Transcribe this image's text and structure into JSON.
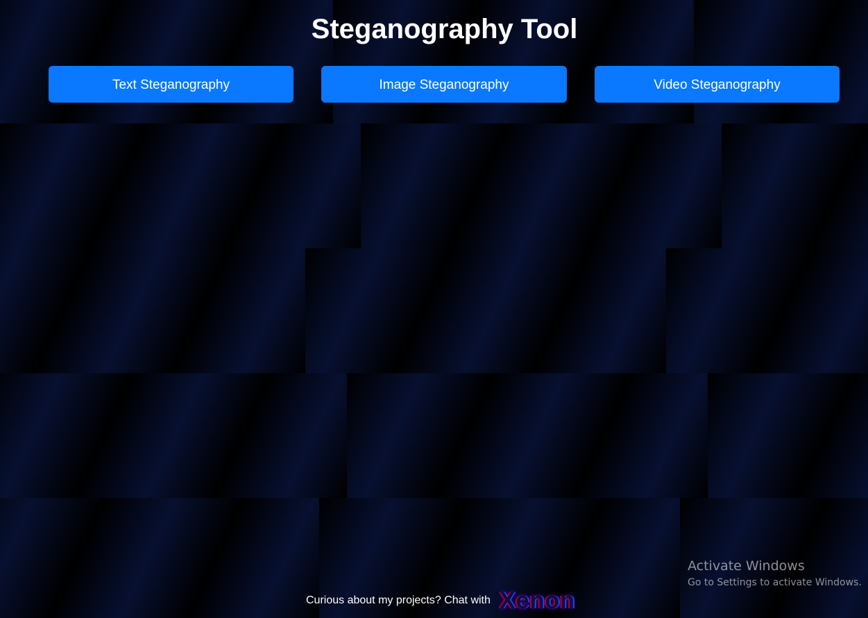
{
  "header": {
    "title": "Steganography Tool"
  },
  "tools": {
    "text_label": "Text Steganography",
    "image_label": "Image Steganography",
    "video_label": "Video Steganography"
  },
  "footer": {
    "prompt": "Curious about my projects? Chat with",
    "link_label": "Xenon"
  },
  "watermark": {
    "title": "Activate Windows",
    "subtitle": "Go to Settings to activate Windows."
  },
  "colors": {
    "button_bg": "#0a78ff",
    "background_dark": "#000000",
    "background_navy": "#071030"
  }
}
